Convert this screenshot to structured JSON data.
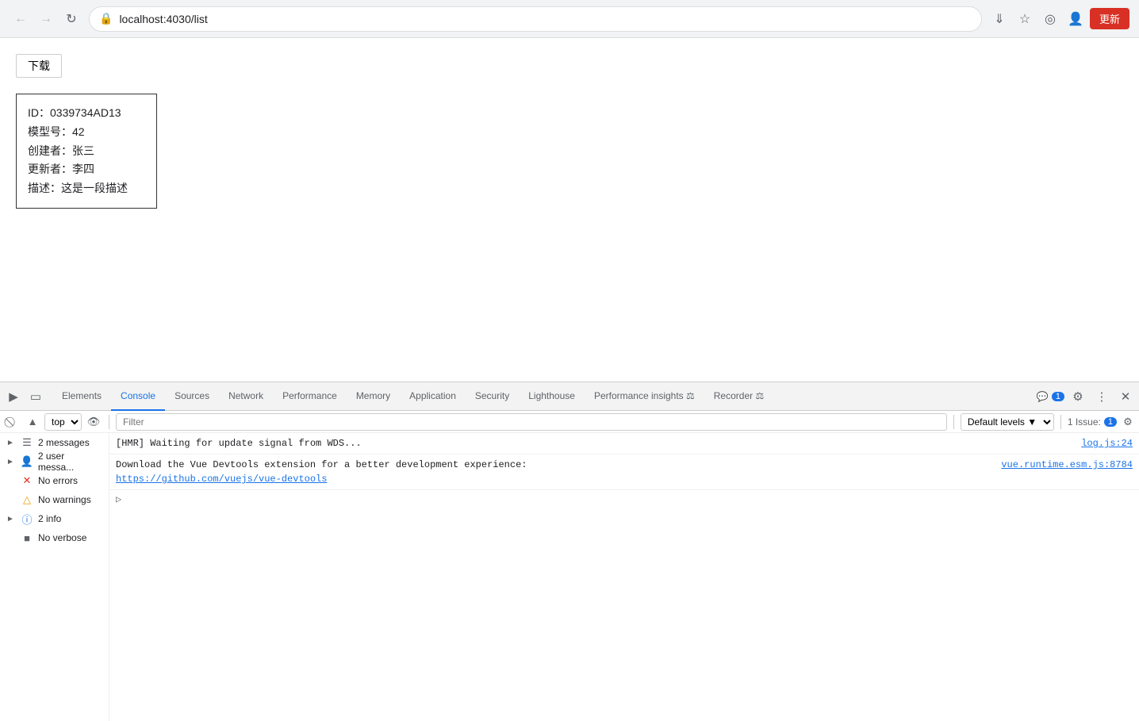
{
  "browser": {
    "url": "localhost:4030/list",
    "update_label": "更新",
    "back_disabled": true,
    "forward_disabled": true
  },
  "page": {
    "download_btn": "下载",
    "card": {
      "id": "ID：0339734AD13",
      "model": "模型号：42",
      "creator": "创建者：张三",
      "updater": "更新者：李四",
      "desc": "描述：这是一段描述"
    }
  },
  "devtools": {
    "tabs": [
      {
        "id": "elements",
        "label": "Elements",
        "active": false
      },
      {
        "id": "console",
        "label": "Console",
        "active": true
      },
      {
        "id": "sources",
        "label": "Sources",
        "active": false
      },
      {
        "id": "network",
        "label": "Network",
        "active": false
      },
      {
        "id": "performance",
        "label": "Performance",
        "active": false
      },
      {
        "id": "memory",
        "label": "Memory",
        "active": false
      },
      {
        "id": "application",
        "label": "Application",
        "active": false
      },
      {
        "id": "security",
        "label": "Security",
        "active": false
      },
      {
        "id": "lighthouse",
        "label": "Lighthouse",
        "active": false
      },
      {
        "id": "performance-insights",
        "label": "Performance insights",
        "active": false
      },
      {
        "id": "recorder",
        "label": "Recorder",
        "active": false
      }
    ],
    "issues_badge": "1",
    "issues_label": "1 Issue:",
    "console_toolbar": {
      "context": "top",
      "filter_placeholder": "Filter",
      "levels_label": "Default levels"
    },
    "sidebar": {
      "items": [
        {
          "label": "2 messages",
          "icon": "messages",
          "expand": true,
          "active": false
        },
        {
          "label": "2 user messa...",
          "icon": "user",
          "expand": true,
          "active": false
        },
        {
          "label": "No errors",
          "icon": "error",
          "expand": false,
          "active": false
        },
        {
          "label": "No warnings",
          "icon": "warning",
          "expand": false,
          "active": false
        },
        {
          "label": "2 info",
          "icon": "info",
          "expand": true,
          "active": false
        },
        {
          "label": "No verbose",
          "icon": "verbose",
          "expand": false,
          "active": false
        }
      ]
    },
    "console": {
      "messages": [
        {
          "text": "[HMR] Waiting for update signal from WDS...",
          "file": "log.js:24",
          "type": "normal",
          "expandable": false
        },
        {
          "text": "Download the Vue Devtools extension for a better development experience:",
          "link": "https://github.com/vuejs/vue-devtools",
          "file": "vue.runtime.esm.js:8784",
          "type": "normal",
          "expandable": true
        }
      ]
    }
  }
}
